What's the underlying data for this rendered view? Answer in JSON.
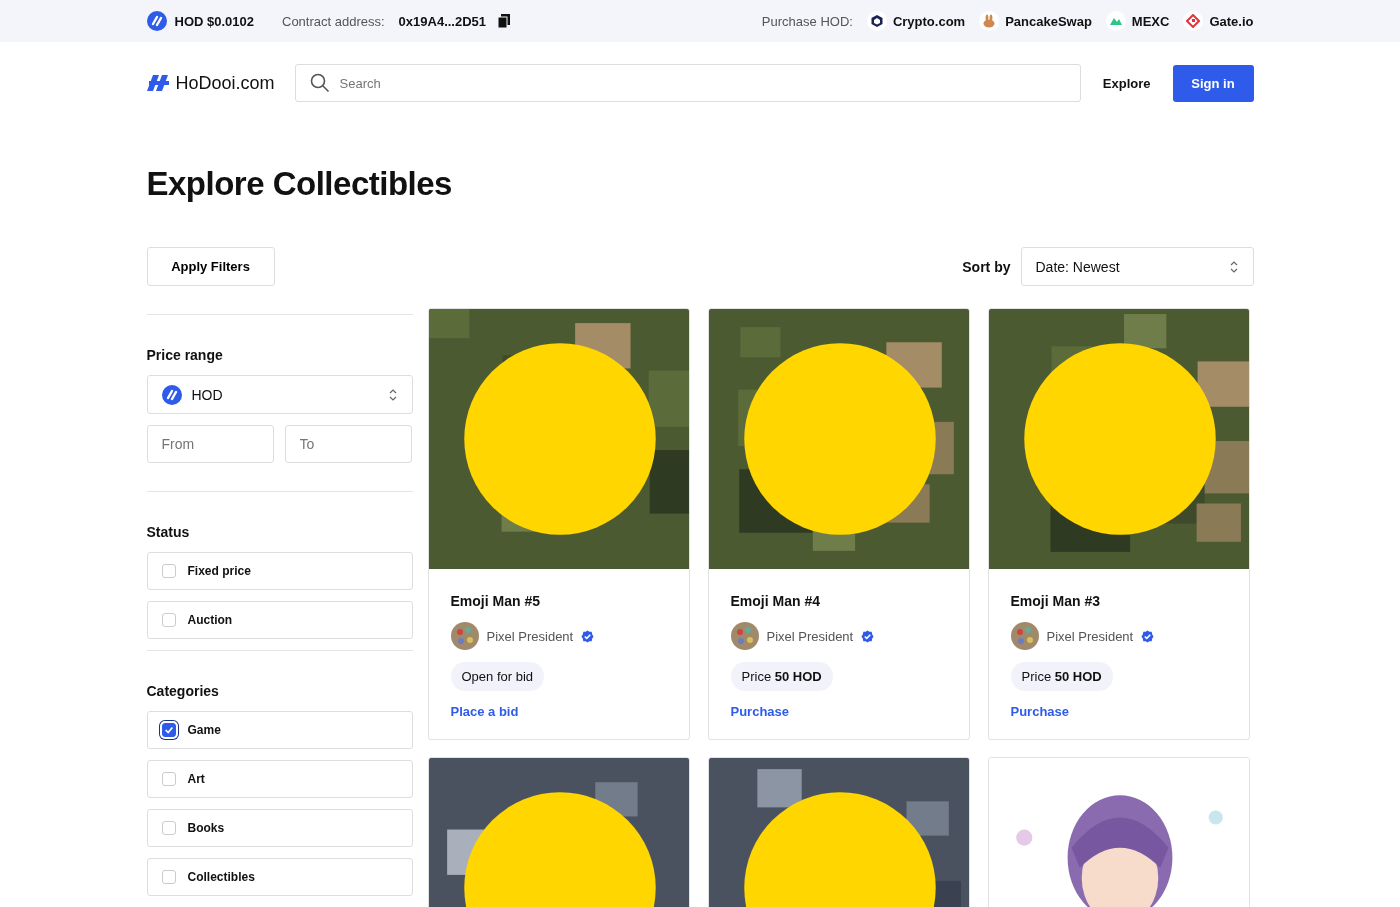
{
  "top_bar": {
    "token_price": "HOD $0.0102",
    "contract_label": "Contract address:",
    "contract_address": "0x19A4...2D51",
    "purchase_label": "Purchase HOD:",
    "exchanges": [
      {
        "name": "Crypto.com",
        "kind": "crypto"
      },
      {
        "name": "PancakeSwap",
        "kind": "pancake"
      },
      {
        "name": "MEXC",
        "kind": "mexc"
      },
      {
        "name": "Gate.io",
        "kind": "gate"
      }
    ]
  },
  "nav": {
    "logo": "HoDooi.com",
    "search": {
      "placeholder": "Search"
    },
    "explore": "Explore",
    "sign_in": "Sign in"
  },
  "page_title": "Explore Collectibles",
  "apply_filters": "Apply Filters",
  "sort": {
    "label": "Sort by",
    "value": "Date: Newest"
  },
  "filters": {
    "price_range": {
      "title": "Price range",
      "currency": "HOD",
      "from": {
        "placeholder": "From"
      },
      "to": {
        "placeholder": "To"
      }
    },
    "status": {
      "title": "Status",
      "options": [
        {
          "label": "Fixed price",
          "checked": false
        },
        {
          "label": "Auction",
          "checked": false
        }
      ]
    },
    "categories": {
      "title": "Categories",
      "options": [
        {
          "label": "Game",
          "checked": true
        },
        {
          "label": "Art",
          "checked": false
        },
        {
          "label": "Books",
          "checked": false
        },
        {
          "label": "Collectibles",
          "checked": false
        }
      ]
    }
  },
  "cards": [
    {
      "kind": "picture",
      "title": "Emoji Man #5",
      "creator": "Pixel President",
      "verified": true,
      "status": "Open for bid",
      "action": "Place a bid"
    },
    {
      "kind": "picture",
      "title": "Emoji Man #4",
      "creator": "Pixel President",
      "verified": true,
      "status": "Price **50 HOD**",
      "action": "Purchase"
    },
    {
      "kind": "picture",
      "title": "Emoji Man #3",
      "creator": "Pixel President",
      "verified": true,
      "status": "Price **50 HOD**",
      "action": "Purchase"
    },
    {
      "kind": "picture"
    },
    {
      "kind": "picture"
    },
    {
      "kind": "picture"
    }
  ]
}
